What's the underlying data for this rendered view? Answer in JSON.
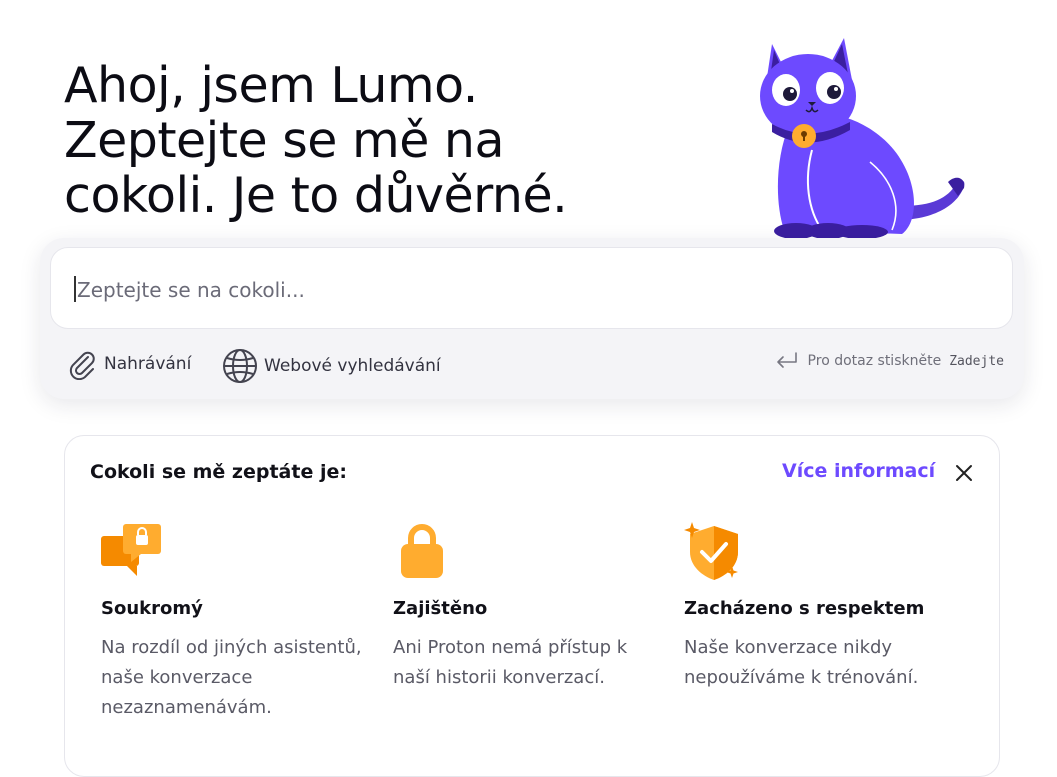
{
  "hero": {
    "line1": "Ahoj, jsem Lumo.",
    "line2": "Zeptejte se mě na",
    "line3": "cokoli. Je to důvěrné."
  },
  "composer": {
    "placeholder": "Zeptejte se na cokoli...",
    "upload_label": "Nahrávání",
    "web_search_label": "Webové vyhledávání",
    "hint_text": "Pro dotaz stiskněte",
    "hint_key": "Zadejte"
  },
  "info": {
    "title": "Cokoli se mě zeptáte je:",
    "more_link": "Více informací",
    "features": [
      {
        "icon": "chat-lock-icon",
        "title": "Soukromý",
        "description": "Na rozdíl od jiných asistentů, naše konverzace nezaznamenávám."
      },
      {
        "icon": "padlock-icon",
        "title": "Zajištěno",
        "description": "Ani Proton nemá přístup k naší historii konverzací."
      },
      {
        "icon": "shield-check-icon",
        "title": "Zacházeno s respektem",
        "description": "Naše konverzace nikdy nepoužíváme k trénování."
      }
    ]
  },
  "colors": {
    "accent": "#6d4aff",
    "mascot_purple": "#6d4aff",
    "icon_orange": "#ffac2f"
  }
}
